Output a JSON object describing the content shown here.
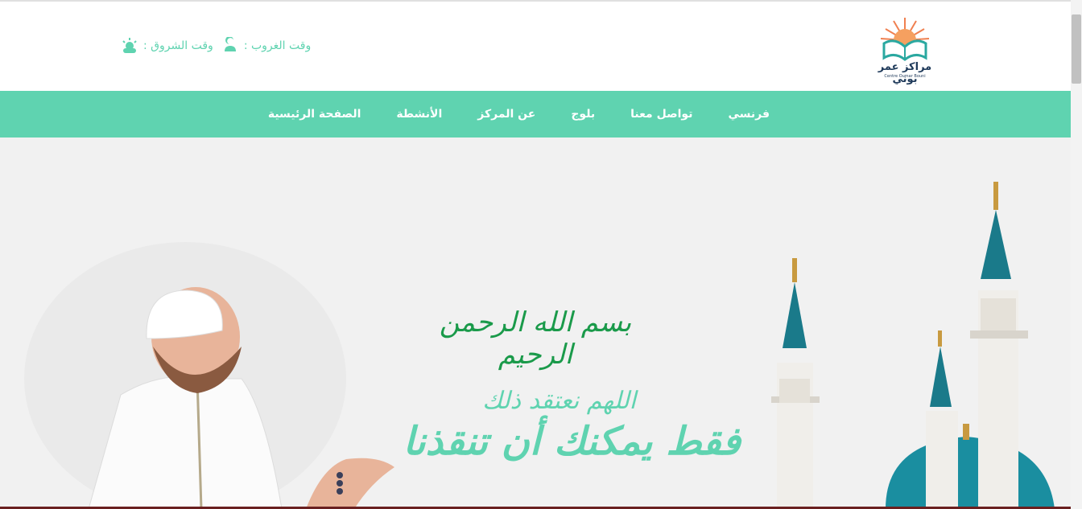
{
  "header": {
    "logo_text": "مراكز عمر بوني",
    "logo_subtext": "Centre Oumar Bouni",
    "sunset_label": "وقت الغروب :",
    "sunrise_label": "وقت الشروق :",
    "icons": [
      "sunset-icon",
      "sunrise-icon"
    ]
  },
  "nav": {
    "items": [
      "الصفحة الرئيسية",
      "الأنشطة",
      "عن المركز",
      "بلوج",
      "تواصل معنا",
      "فرنسي"
    ]
  },
  "hero": {
    "basmala": "بسم الله الرحمن الرحيم",
    "subtitle": "اللهم نعتقد ذلك",
    "headline": "فقط يمكنك أن تنقذنا"
  },
  "colors": {
    "accent": "#5fd3b0",
    "nav_bg": "#5fd3b0",
    "hero_bg": "#f1f1f1",
    "basmala": "#1a9a4a",
    "dome": "#1a8ea0"
  }
}
